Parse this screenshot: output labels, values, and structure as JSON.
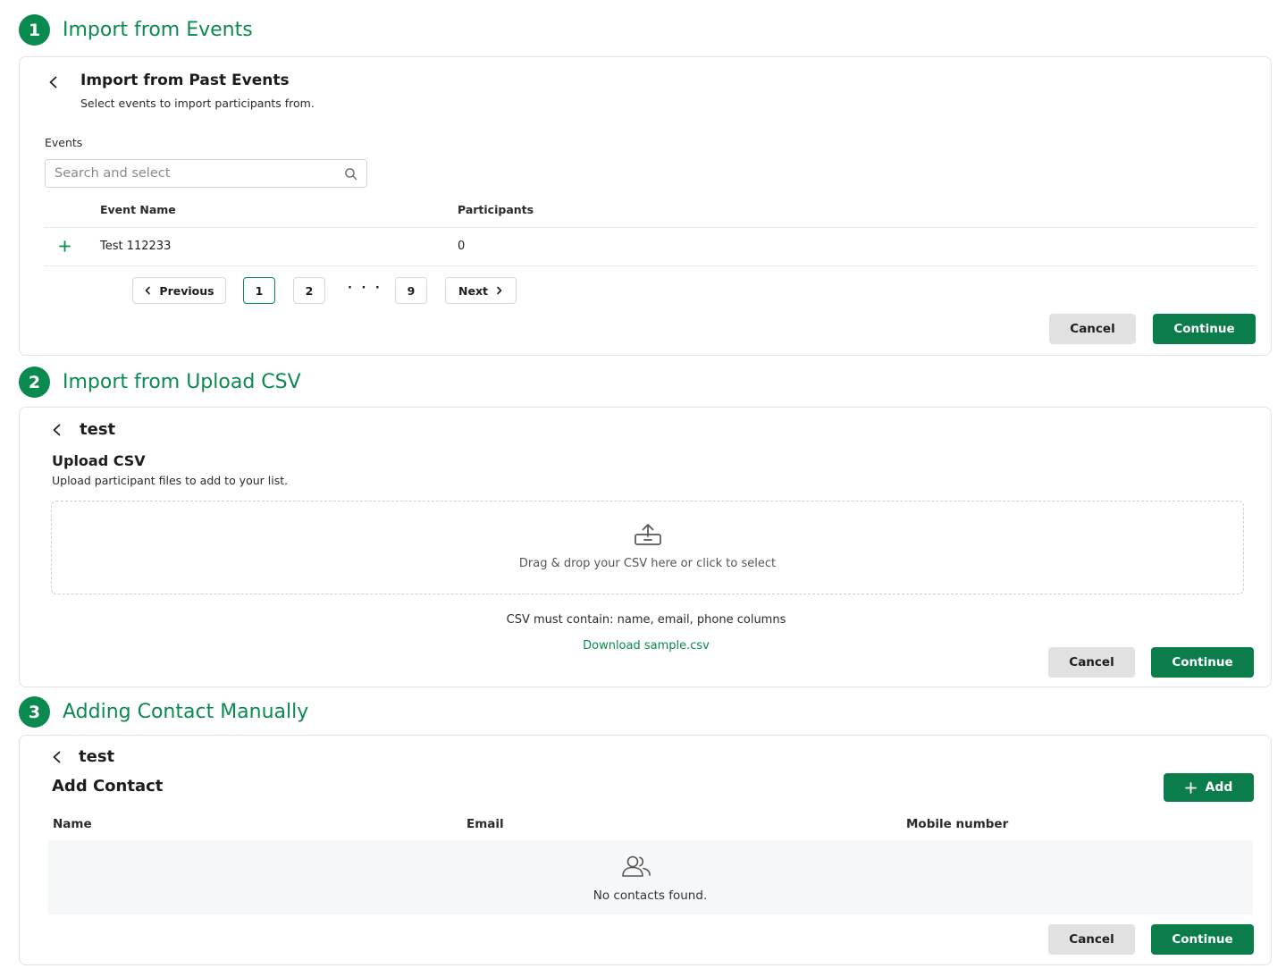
{
  "step1": {
    "number": "1",
    "title": "Import from Events",
    "heading": "Import from Past Events",
    "subtitle": "Select events to import participants from.",
    "field_label": "Events",
    "search_placeholder": "Search and select",
    "table": {
      "columns": [
        "Event Name",
        "Participants"
      ],
      "rows": [
        {
          "name": "Test 112233",
          "participants": "0"
        }
      ]
    },
    "pagination": {
      "previous": "Previous",
      "pages": [
        "1",
        "2",
        "9"
      ],
      "ellipsis": "· · ·",
      "next": "Next",
      "current": "1"
    },
    "cancel": "Cancel",
    "continue": "Continue"
  },
  "step2": {
    "number": "2",
    "title": "Import from Upload CSV",
    "list_name": "test",
    "heading": "Upload CSV",
    "subtitle": "Upload participant files to add to your list.",
    "dropzone_text": "Drag & drop your CSV here or click to select",
    "requirement": "CSV must contain: name, email, phone columns",
    "download_link": "Download sample.csv",
    "cancel": "Cancel",
    "continue": "Continue"
  },
  "step3": {
    "number": "3",
    "title": "Adding Contact Manually",
    "list_name": "test",
    "heading": "Add Contact",
    "add_button": "Add",
    "columns": [
      "Name",
      "Email",
      "Mobile number"
    ],
    "empty_text": "No contacts found.",
    "cancel": "Cancel",
    "continue": "Continue"
  },
  "colors": {
    "accent": "#0a8a4f",
    "button_primary": "#0a7d4a",
    "button_secondary": "#e1e1e1"
  }
}
